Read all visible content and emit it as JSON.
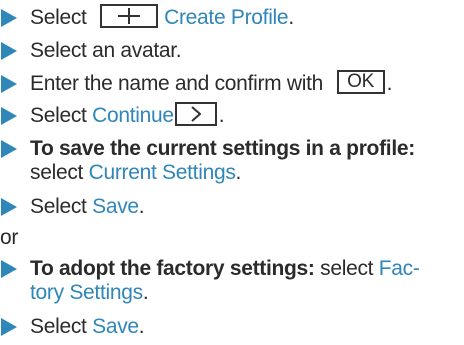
{
  "steps_a": [
    {
      "parts": [
        {
          "t": "Select "
        },
        {
          "key": "plus-icon"
        },
        {
          "link": "Create Profile"
        },
        {
          "t": "."
        }
      ]
    },
    {
      "parts": [
        {
          "t": "Select an avatar."
        }
      ]
    },
    {
      "parts": [
        {
          "t": "Enter the name and confirm with "
        },
        {
          "key": "OK"
        },
        {
          "t": "."
        }
      ]
    },
    {
      "parts": [
        {
          "t": "Select "
        },
        {
          "link": "Continue"
        },
        {
          "key": "chevron-right-icon"
        },
        {
          "t": "."
        }
      ]
    }
  ],
  "step5": {
    "bold": "To save the current settings in a profile:",
    "text": "select ",
    "link": "Current Settings",
    "end": "."
  },
  "step6": {
    "text": "Select ",
    "link": "Save",
    "end": "."
  },
  "or_text": "or",
  "step7": {
    "bold": "To adopt the factory settings:",
    "text": " select ",
    "link_a": "Fac-",
    "link_b": "tory Settings",
    "end": "."
  },
  "step8": {
    "text": "Select ",
    "link": "Save",
    "end": "."
  },
  "labels": {
    "ok_key": "OK"
  },
  "colors": {
    "bullet": "#2f86b8",
    "link": "#2f86b8",
    "text": "#2b2b2b"
  }
}
